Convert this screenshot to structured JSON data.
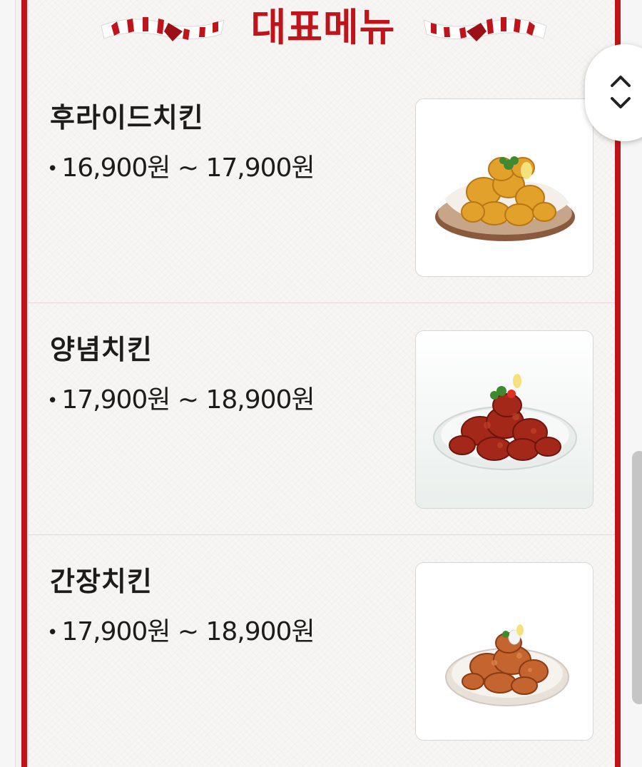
{
  "section_title": "대표메뉴",
  "items": [
    {
      "name": "후라이드치킨",
      "price": "16,900원 ~ 17,900원",
      "photo_icon": "fried-chicken-photo"
    },
    {
      "name": "양념치킨",
      "price": "17,900원 ~ 18,900원",
      "photo_icon": "seasoned-chicken-photo"
    },
    {
      "name": "간장치킨",
      "price": "17,900원 ~ 18,900원",
      "photo_icon": "soy-chicken-photo"
    }
  ],
  "colors": {
    "accent": "#c0141b",
    "text": "#1c1c1c",
    "background": "#f7f6f4"
  },
  "scroll_button_icon": "chevron-up-down-icon"
}
